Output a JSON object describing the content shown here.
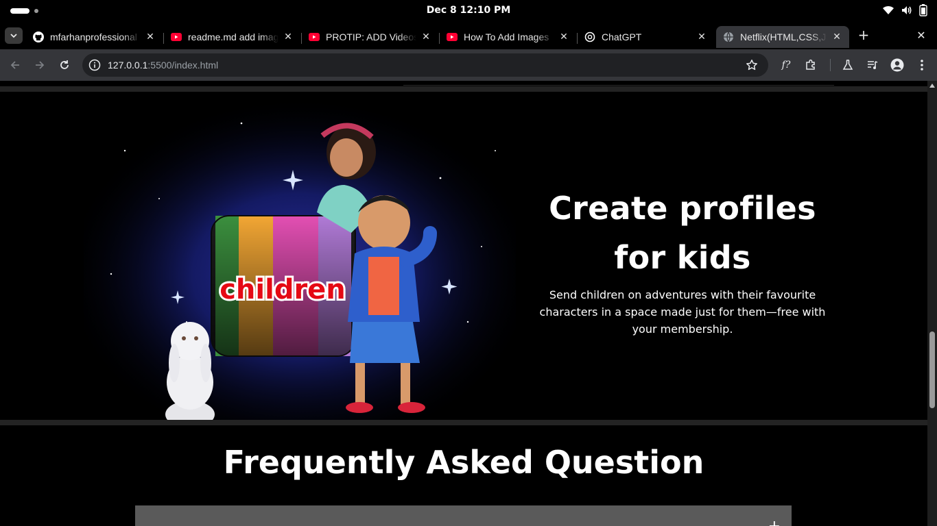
{
  "os": {
    "clock": "Dec 8  12:10 PM"
  },
  "tabs": [
    {
      "title": "mfarhanprofessional",
      "icon": "github-icon",
      "active": false
    },
    {
      "title": "readme.md add image",
      "icon": "youtube-icon",
      "active": false
    },
    {
      "title": "PROTIP: ADD Videos",
      "icon": "youtube-icon",
      "active": false
    },
    {
      "title": "How To Add Images",
      "icon": "youtube-icon",
      "active": false
    },
    {
      "title": "ChatGPT",
      "icon": "chatgpt-icon",
      "active": false
    },
    {
      "title": "Netflix(HTML,CSS,JS)",
      "icon": "globe-icon",
      "active": true
    }
  ],
  "tabstrip": {
    "new_tab": "+",
    "close_window": "✕",
    "close_tab": "✕"
  },
  "toolbar": {
    "url_host": "127.0.0.1",
    "url_path": ":5500/index.html"
  },
  "kids": {
    "heading": "Create profiles for kids",
    "body": "Send children on adventures with their favourite characters in a space made just for them—free with your membership.",
    "logo_text": "children"
  },
  "faq": {
    "title": "Frequently Asked Question",
    "first_item_plus": "+"
  },
  "colors": {
    "tab_active": "#35363a",
    "toolbar": "#35363a",
    "omnibox": "#202124",
    "page_bg": "#000000",
    "faq_item_bg": "#5a5a5a",
    "logo_red": "#e50914"
  }
}
